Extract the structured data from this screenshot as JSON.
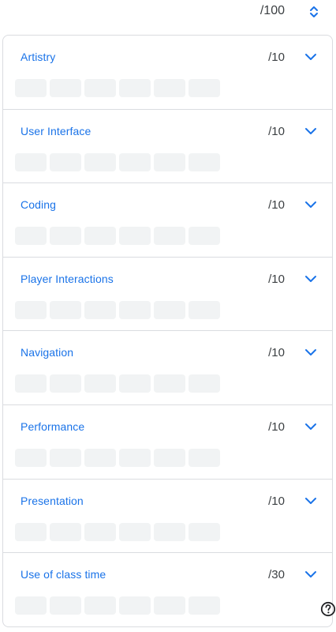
{
  "total": {
    "label": "/100"
  },
  "sections": [
    {
      "title": "Artistry",
      "score": "/10"
    },
    {
      "title": "User Interface",
      "score": "/10"
    },
    {
      "title": "Coding",
      "score": "/10"
    },
    {
      "title": "Player Interactions",
      "score": "/10"
    },
    {
      "title": "Navigation",
      "score": "/10"
    },
    {
      "title": "Performance",
      "score": "/10"
    },
    {
      "title": "Presentation",
      "score": "/10"
    },
    {
      "title": "Use of class time",
      "score": "/30"
    }
  ],
  "icons": {
    "total_toggle": "unfold-icon",
    "section_toggle": "chevron-down-icon",
    "help": "help-icon"
  },
  "colors": {
    "accent": "#1a73e8",
    "placeholder": "#f1f3f4",
    "border": "#dadce0"
  }
}
